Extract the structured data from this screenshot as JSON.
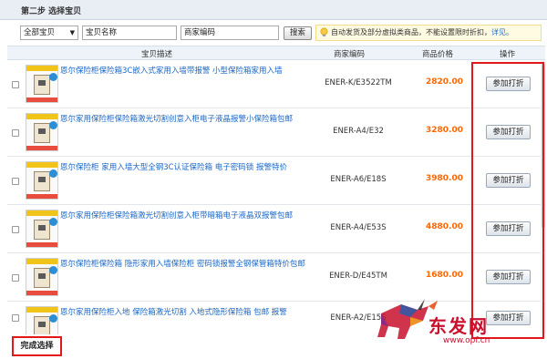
{
  "step": {
    "title": "第二步 选择宝贝"
  },
  "filters": {
    "category_selected": "全部宝贝",
    "name_value": "宝贝名称",
    "code_value": "商家编码",
    "search_label": "搜索"
  },
  "notice": {
    "text": "自动发货及部分虚拟类商品，不能设置限时折扣，",
    "link": "详见。"
  },
  "table": {
    "headers": [
      "宝贝描述",
      "商家编码",
      "商品价格",
      "操作"
    ],
    "action_label": "参加打折",
    "rows": [
      {
        "title": "恩尔保险柜保险箱3C嵌入式家用入墙带报警 小型保险箱家用入墙",
        "code": "ENER-K/E3522TM",
        "price": "2820.00"
      },
      {
        "title": "恩尔家用保险柜保险箱激光切割创意入柜电子液晶报警小保险箱包邮",
        "code": "ENER-A4/E32",
        "price": "3280.00"
      },
      {
        "title": "恩尔保险柜 家用入墙大型全钢3C认证保险箱 电子密码锁 报警特价",
        "code": "ENER-A6/E18S",
        "price": "3980.00"
      },
      {
        "title": "恩尔家用保险柜保险箱激光切割创意入柜带暗箱电子液晶双报警包邮",
        "code": "ENER-A4/E53S",
        "price": "4880.00"
      },
      {
        "title": "恩尔保险柜保险箱 隐形家用入墙保险柜 密码锁报警全钢保管箱特价包邮",
        "code": "ENER-D/E45TM",
        "price": "1680.00"
      },
      {
        "title": "恩尔家用保险柜入地 保险箱激光切割 入地式隐形保险箱 包邮 报警",
        "code": "ENER-A2/E15S",
        "price": ""
      }
    ]
  },
  "footer": {
    "complete_label": "完成选择"
  },
  "watermark": {
    "brand": "东发网",
    "url": "www.opf.cn"
  },
  "colors": {
    "accent_red": "#e2171c",
    "price_orange": "#ff6600",
    "link_blue": "#1a66c6"
  }
}
